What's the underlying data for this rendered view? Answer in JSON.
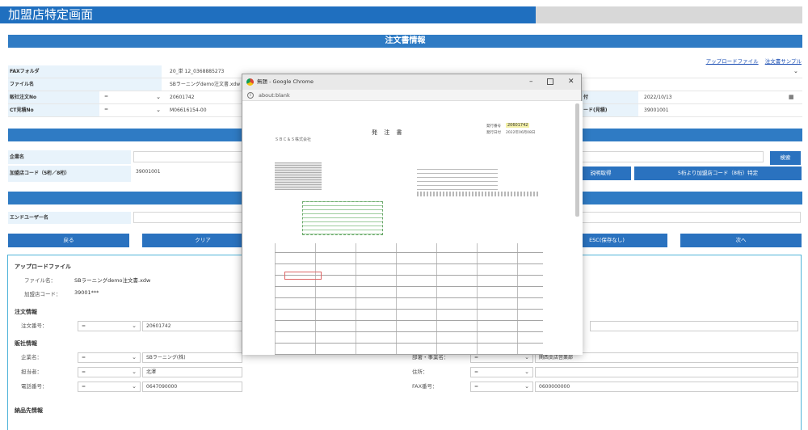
{
  "page": {
    "title": "加盟店特定画面",
    "section_order": "注文書情報",
    "links": [
      "アップロードファイル",
      "注文書サンプル"
    ]
  },
  "form": {
    "fax_folder_label": "FAXフォルダ",
    "fax_folder_value": "20_単 12_0368885273",
    "file_name_label": "ファイル名",
    "file_name_value": "SBラーニングdemo注文書.xdw",
    "order_no_label": "販社注文No",
    "order_no_select": "=",
    "order_no_value": "20601742",
    "ct_no_label": "CT見積No",
    "ct_no_select": "=",
    "ct_no_value": "M06616154-00",
    "date_label": "付",
    "date_value": "2022/10/13",
    "code_label": "ード(見積)",
    "code_value": "39001001"
  },
  "company": {
    "company_label": "企業名",
    "search_button": "検索",
    "store_code_label": "加盟店コード（5桁／8桁）",
    "store_code_value": "39001001",
    "explain_button": "説明取得",
    "identify_button": "5桁より加盟店コード（8桁）特定",
    "enduser_label": "エンドユーザー名"
  },
  "buttons": {
    "back": "戻る",
    "clear": "クリア",
    "esc": "ESC(保存なし)",
    "next": "次へ"
  },
  "panel": {
    "upload_heading": "アップロードファイル",
    "file_name_label": "ファイル名：",
    "file_name_value": "SBラーニングdemo注文書.xdw",
    "store_code_label": "加盟店コード：",
    "store_code_value": "39001***",
    "order_heading": "注文情報",
    "order_no_label": "注文番号：",
    "order_no_select": "=",
    "order_no_value": "20601742",
    "dealer_heading": "販社情報",
    "company_label": "企業名：",
    "company_select": "=",
    "company_value": "SBラーニング(株)",
    "dept_label": "部署・事業名：",
    "dept_select": "=",
    "dept_value": "関西支店営業部",
    "person_label": "担当者：",
    "person_select": "=",
    "person_value": "北澤",
    "address_label": "住所：",
    "address_select": "=",
    "phone_label": "電話番号：",
    "phone_select": "=",
    "phone_value": "0647090000",
    "fax_label": "FAX番号：",
    "fax_select": "=",
    "fax_value": "0600000000",
    "delivery_heading": "納品先情報"
  },
  "popup": {
    "title": "無題 - Google Chrome",
    "address": "about:blank",
    "doc_title": "発 注 書",
    "doc_company": "ＳＢＣ＆Ｓ株式会社",
    "doc_number_label": "発行番号",
    "doc_number": "20601742",
    "doc_date_label": "発行日付",
    "doc_date": "2022年06月08日"
  },
  "colors": {
    "title_blue": "#1f6fbf",
    "section_blue": "#2f7bc4",
    "button_blue": "#2a72bf",
    "label_bg": "#e8f3fb",
    "panel_border": "#4fb3d9"
  }
}
